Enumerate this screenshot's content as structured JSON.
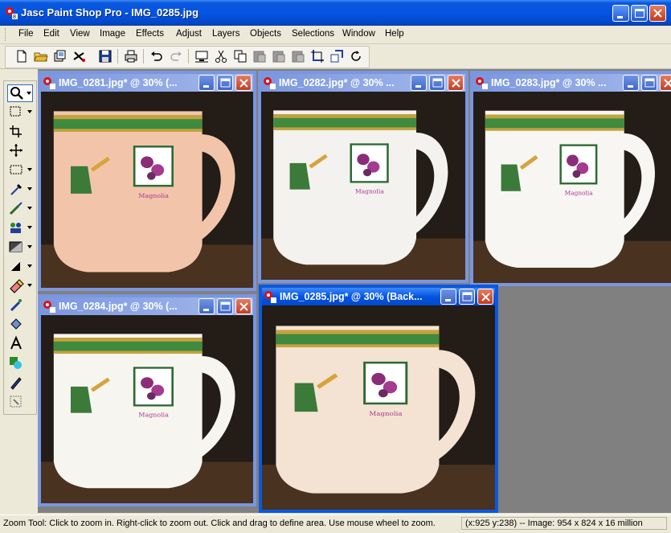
{
  "window": {
    "title": "Jasc Paint Shop Pro - IMG_0285.jpg",
    "buttons": [
      "minimize",
      "maximize",
      "close"
    ],
    "accent": "#0554e3"
  },
  "menu": [
    "File",
    "Edit",
    "View",
    "Image",
    "Effects",
    "Adjust",
    "Layers",
    "Objects",
    "Selections",
    "Window",
    "Help"
  ],
  "toolbar_icons": [
    "new-icon",
    "open-icon",
    "browse-icon",
    "scan-icon",
    "save-icon",
    "print-icon",
    "undo-icon",
    "redo-icon",
    "screen-capture-icon",
    "cut-icon",
    "copy-icon",
    "paste-icon",
    "paste-new-layer-icon",
    "paste-selection-icon",
    "crop-icon",
    "resize-icon",
    "rotate-icon"
  ],
  "tools": [
    "zoom-tool",
    "selection-tool",
    "crop-tool",
    "move-tool",
    "marquee-tool",
    "dropper-tool",
    "paint-brush-tool",
    "clone-tool",
    "gradient-tool",
    "dodge-tool",
    "eraser-tool",
    "picture-tube-tool",
    "fill-tool",
    "text-tool",
    "shape-tool",
    "pen-tool",
    "warp-tool"
  ],
  "documents": [
    {
      "title": "IMG_0281.jpg* @  30% (...",
      "tint": "#f2c5ab"
    },
    {
      "title": "IMG_0282.jpg* @  30% ...",
      "tint": "#f4f2ee"
    },
    {
      "title": "IMG_0283.jpg* @  30% ...",
      "tint": "#f7f6f3"
    },
    {
      "title": "IMG_0284.jpg* @  30% (...",
      "tint": "#f7f5f0"
    },
    {
      "title": "IMG_0285.jpg* @  30% (Back...",
      "tint": "#f4e3d2"
    }
  ],
  "status": {
    "hint": "Zoom Tool: Click to zoom in. Right-click to zoom out. Click and drag to define area. Use mouse wheel to zoom.",
    "info": "(x:925 y:238) -- Image:  954 x 824 x 16 million"
  }
}
